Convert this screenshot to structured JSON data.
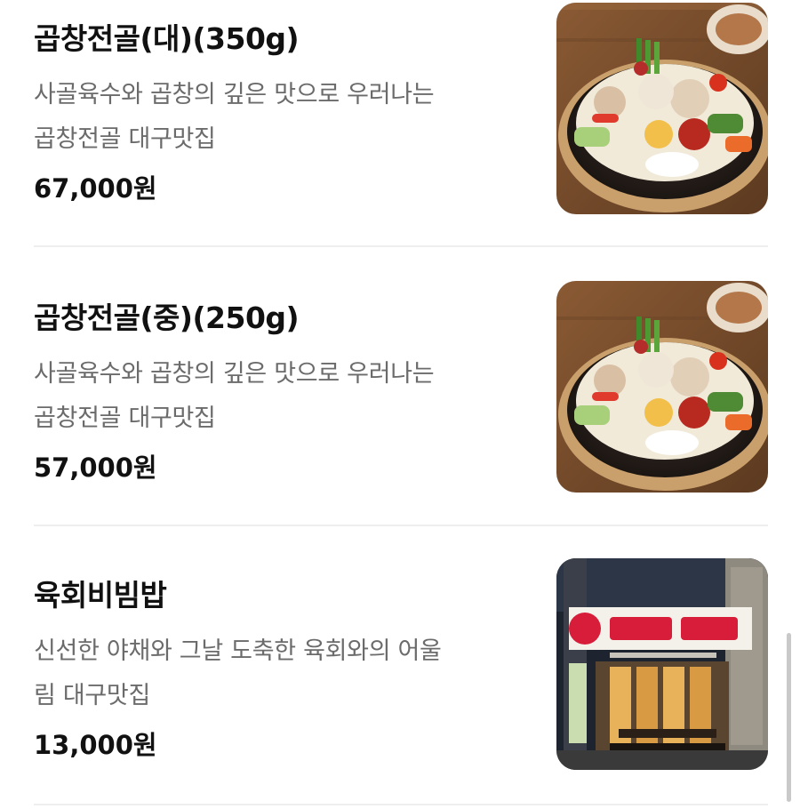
{
  "menu": {
    "items": [
      {
        "name": "곱창전골(대)(350g)",
        "desc_line1": "사골육수와 곱창의 깊은 맛으로 우러나는",
        "desc_line2": "곱창전골 대구맛집",
        "price": "67,000원",
        "image": "hotpot-photo"
      },
      {
        "name": "곱창전골(중)(250g)",
        "desc_line1": "사골육수와 곱창의 깊은 맛으로 우러나는",
        "desc_line2": "곱창전골 대구맛집",
        "price": "57,000원",
        "image": "hotpot-photo"
      },
      {
        "name": "육회비빔밥",
        "desc_line1": "신선한 야채와 그날 도축한 육회와의 어울",
        "desc_line2": "림 대구맛집",
        "price": "13,000원",
        "image": "storefront-photo"
      }
    ]
  },
  "colors": {
    "title": "#111111",
    "description": "#6b6b6b",
    "divider": "#eeeeee",
    "scrollbar": "#c9c9c9",
    "sign_red": "#d81d3a"
  }
}
